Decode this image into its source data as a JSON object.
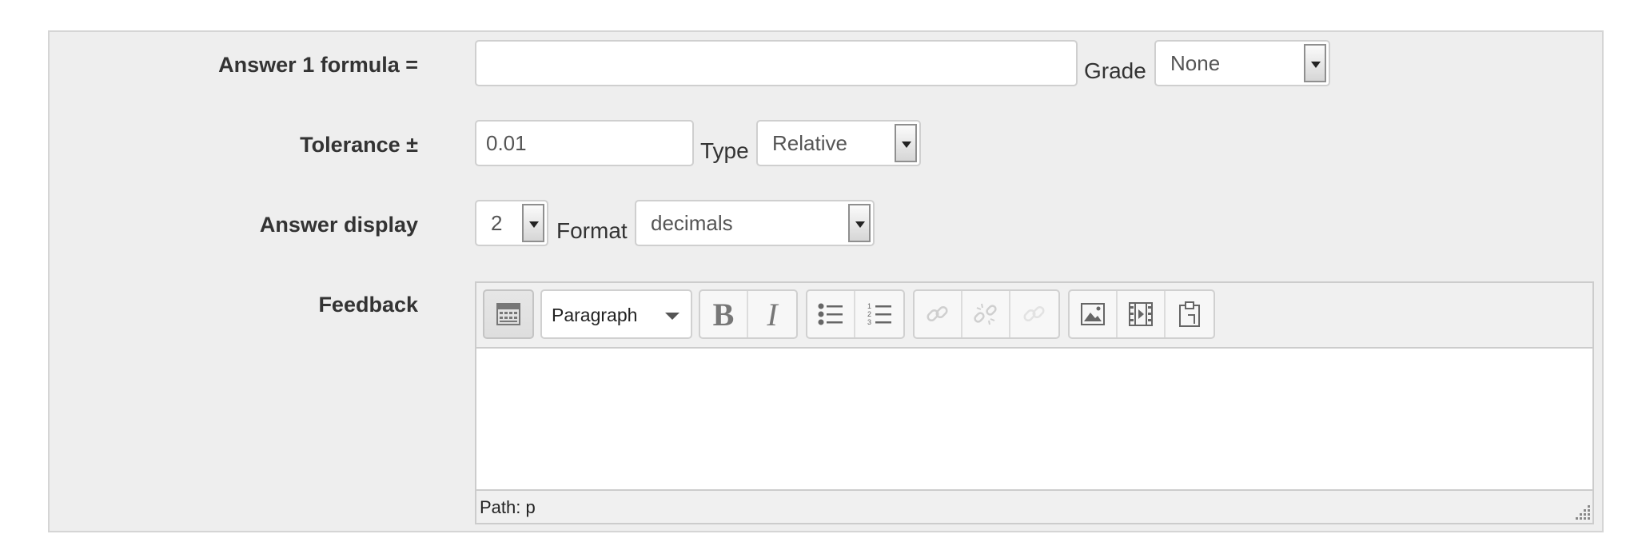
{
  "answer_formula": {
    "label": "Answer 1 formula =",
    "value": ""
  },
  "grade": {
    "label": "Grade",
    "selected": "None"
  },
  "tolerance": {
    "label": "Tolerance ±",
    "value": "0.01"
  },
  "type": {
    "label": "Type",
    "selected": "Relative"
  },
  "answer_display": {
    "label": "Answer display",
    "selected": "2"
  },
  "format": {
    "label": "Format",
    "selected": "decimals"
  },
  "feedback": {
    "label": "Feedback",
    "editor": {
      "toolbar": {
        "toggle_icon": "toolbar-toggle-icon",
        "block_format": "Paragraph",
        "bold": "B",
        "italic": "I",
        "icons": [
          "unordered-list-icon",
          "ordered-list-icon",
          "link-icon",
          "unlink-icon",
          "anchor-icon",
          "image-icon",
          "media-icon",
          "paste-icon"
        ]
      },
      "content": "",
      "path": "Path: p"
    }
  }
}
